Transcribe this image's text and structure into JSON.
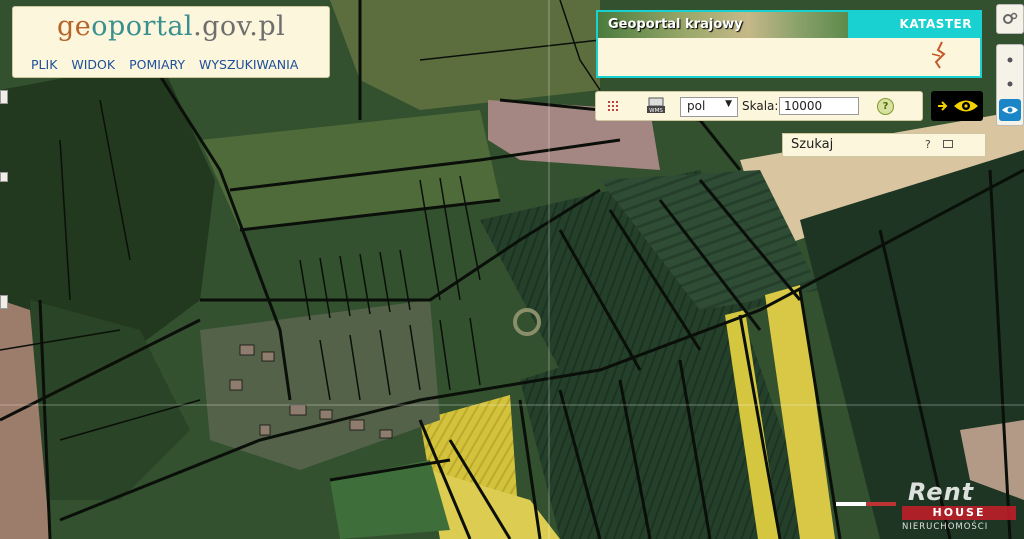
{
  "logo": {
    "part1": "ge",
    "part2": "oportal",
    "part3": ".gov.pl"
  },
  "menu": [
    "PLIK",
    "WIDOK",
    "POMIARY",
    "WYSZUKIWANIA"
  ],
  "banner": {
    "title": "Geoportal krajowy",
    "layer": "KATASTER",
    "accent": "#1ad1d1"
  },
  "toolbar": {
    "layers_icon": "grid-icon",
    "wms_icon": "wms-icon",
    "language": "pol",
    "scale_label": "Skala:",
    "scale_value": "10000",
    "help_label": "?"
  },
  "eye_button": {
    "icon": "eye-icon",
    "arrow": "arrow-right-icon"
  },
  "search": {
    "label": "Szukaj",
    "help": "?"
  },
  "watermark": {
    "brand": "Rent",
    "brand2": "HOUSE",
    "sub": "NIERUCHOMOŚCI"
  },
  "colors": {
    "panel_bg": "#fbf6dc",
    "menu_link": "#1e4f9a",
    "parcel_line": "#0b0f09"
  }
}
